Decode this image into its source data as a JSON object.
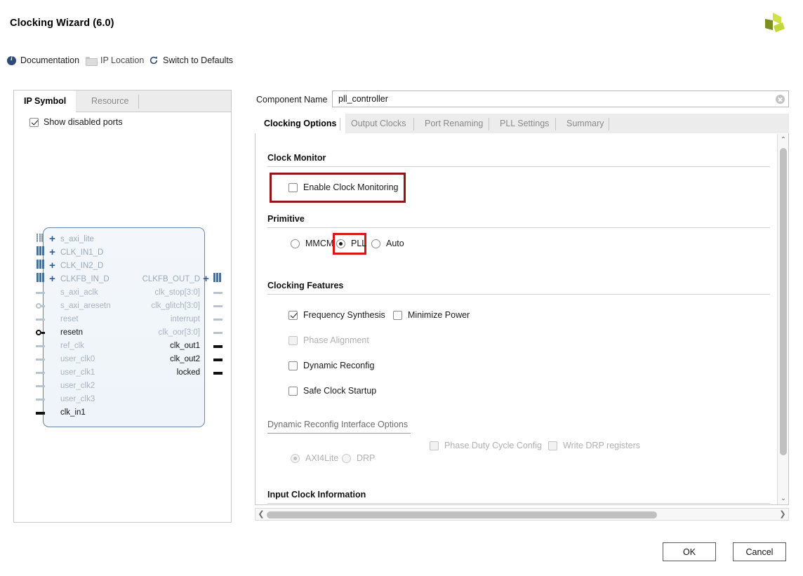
{
  "window": {
    "title": "Clocking Wizard (6.0)",
    "logo_colors": [
      "#b9cf2e",
      "#d4e04a",
      "#7d8f1e"
    ]
  },
  "toolbar": {
    "documentation": "Documentation",
    "ip_location": "IP Location",
    "switch_defaults": "Switch to Defaults",
    "icons": [
      "info-icon",
      "folder-icon",
      "refresh-icon"
    ]
  },
  "left_panel": {
    "tabs": [
      {
        "label": "IP Symbol",
        "active": true
      },
      {
        "label": "Resource",
        "active": false
      }
    ],
    "show_disabled_ports": {
      "label": "Show disabled ports",
      "checked": true
    },
    "symbol": {
      "left_ports": [
        {
          "name": "s_axi_lite",
          "type": "bus",
          "enabled": false,
          "marker": "dots"
        },
        {
          "name": "CLK_IN1_D",
          "type": "bus",
          "enabled": false,
          "marker": "bars"
        },
        {
          "name": "CLK_IN2_D",
          "type": "bus",
          "enabled": false,
          "marker": "bars"
        },
        {
          "name": "CLKFB_IN_D",
          "type": "bus",
          "enabled": false,
          "marker": "bars"
        },
        {
          "name": "s_axi_aclk",
          "type": "pin",
          "enabled": false,
          "marker": "stub"
        },
        {
          "name": "s_axi_aresetn",
          "type": "pin",
          "enabled": false,
          "marker": "bubble"
        },
        {
          "name": "reset",
          "type": "pin",
          "enabled": false,
          "marker": "stub"
        },
        {
          "name": "resetn",
          "type": "pin",
          "enabled": true,
          "marker": "bubble"
        },
        {
          "name": "ref_clk",
          "type": "pin",
          "enabled": false,
          "marker": "stub"
        },
        {
          "name": "user_clk0",
          "type": "pin",
          "enabled": false,
          "marker": "stub"
        },
        {
          "name": "user_clk1",
          "type": "pin",
          "enabled": false,
          "marker": "stub"
        },
        {
          "name": "user_clk2",
          "type": "pin",
          "enabled": false,
          "marker": "stub"
        },
        {
          "name": "user_clk3",
          "type": "pin",
          "enabled": false,
          "marker": "stub"
        },
        {
          "name": "clk_in1",
          "type": "pin",
          "enabled": true,
          "marker": "stub"
        }
      ],
      "right_ports": [
        {
          "name": "CLKFB_OUT_D",
          "type": "bus",
          "enabled": false,
          "marker": "bars"
        },
        {
          "name": "clk_stop[3:0]",
          "type": "pin",
          "enabled": false,
          "marker": "stub"
        },
        {
          "name": "clk_glitch[3:0]",
          "type": "pin",
          "enabled": false,
          "marker": "stub"
        },
        {
          "name": "interrupt",
          "type": "pin",
          "enabled": false,
          "marker": "stub"
        },
        {
          "name": "clk_oor[3:0]",
          "type": "pin",
          "enabled": false,
          "marker": "stub"
        },
        {
          "name": "clk_out1",
          "type": "pin",
          "enabled": true,
          "marker": "stub"
        },
        {
          "name": "clk_out2",
          "type": "pin",
          "enabled": true,
          "marker": "stub"
        },
        {
          "name": "locked",
          "type": "pin",
          "enabled": true,
          "marker": "stub"
        }
      ]
    }
  },
  "right_panel": {
    "component_name": {
      "label": "Component Name",
      "value": "pll_controller"
    },
    "tabs": [
      {
        "label": "Clocking Options",
        "active": true
      },
      {
        "label": "Output Clocks",
        "active": false
      },
      {
        "label": "Port Renaming",
        "active": false
      },
      {
        "label": "PLL Settings",
        "active": false
      },
      {
        "label": "Summary",
        "active": false
      }
    ],
    "sections": {
      "clock_monitor": {
        "title": "Clock Monitor",
        "enable_clock_monitoring": {
          "label": "Enable Clock Monitoring",
          "checked": false,
          "highlighted": true,
          "highlight_color": "#8f1616"
        }
      },
      "primitive": {
        "title": "Primitive",
        "options": [
          {
            "label": "MMCM",
            "selected": false,
            "highlighted": false
          },
          {
            "label": "PLL",
            "selected": true,
            "highlighted": true
          },
          {
            "label": "Auto",
            "selected": false,
            "highlighted": false
          }
        ],
        "highlight_color": "#d81616"
      },
      "clocking_features": {
        "title": "Clocking Features",
        "options": [
          {
            "label": "Frequency Synthesis",
            "checked": true,
            "enabled": true
          },
          {
            "label": "Minimize Power",
            "checked": false,
            "enabled": true
          },
          {
            "label": "Phase Alignment",
            "checked": false,
            "enabled": false
          },
          {
            "label": "Dynamic Reconfig",
            "checked": false,
            "enabled": true
          },
          {
            "label": "Safe Clock Startup",
            "checked": false,
            "enabled": true
          }
        ]
      },
      "dynamic_reconfig": {
        "title": "Dynamic Reconfig Interface Options",
        "radios": [
          {
            "label": "AXI4Lite",
            "selected": true,
            "enabled": false
          },
          {
            "label": "DRP",
            "selected": false,
            "enabled": false
          }
        ],
        "checks": [
          {
            "label": "Phase Duty Cycle Config",
            "checked": false,
            "enabled": false
          },
          {
            "label": "Write DRP registers",
            "checked": false,
            "enabled": false
          }
        ]
      },
      "input_clock_information": {
        "title": "Input Clock Information"
      }
    }
  },
  "footer": {
    "ok": "OK",
    "cancel": "Cancel"
  },
  "scroll": {
    "up_arrow": "⌃",
    "down_arrow": "⌄",
    "left_arrow": "❮",
    "right_arrow": "❯"
  }
}
